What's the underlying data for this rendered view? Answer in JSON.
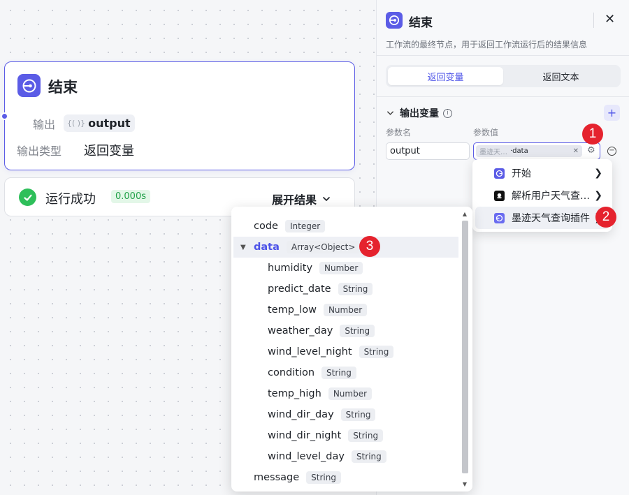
{
  "node": {
    "title": "结束",
    "output_label": "输出",
    "output_var": "output",
    "output_type_label": "输出类型",
    "output_type_value": "返回变量"
  },
  "run": {
    "status": "运行成功",
    "time": "0.000s",
    "expand_label": "展开结果"
  },
  "panel": {
    "title": "结束",
    "description": "工作流的最终节点，用于返回工作流运行后的结果信息",
    "tabs": [
      {
        "label": "返回变量",
        "active": true
      },
      {
        "label": "返回文本",
        "active": false
      }
    ],
    "section_title": "输出变量",
    "param_name_label": "参数名",
    "param_value_label": "参数值",
    "param_name": "output",
    "ref_source": "墨迹天…",
    "ref_field": "·data"
  },
  "source_menu": [
    {
      "label": "开始",
      "icon": "start-icon"
    },
    {
      "label": "解析用户天气查…",
      "icon": "parse-node-icon"
    },
    {
      "label": "墨迹天气查询插件",
      "icon": "moji-plugin-icon",
      "hovered": true
    }
  ],
  "callouts": [
    "1",
    "2",
    "3"
  ],
  "field_tree": [
    {
      "name": "code",
      "type": "Integer",
      "level": 0
    },
    {
      "name": "data",
      "type": "Array<Object>",
      "level": 0,
      "expanded": true,
      "selected": true
    },
    {
      "name": "humidity",
      "type": "Number",
      "level": 1
    },
    {
      "name": "predict_date",
      "type": "String",
      "level": 1
    },
    {
      "name": "temp_low",
      "type": "Number",
      "level": 1
    },
    {
      "name": "weather_day",
      "type": "String",
      "level": 1
    },
    {
      "name": "wind_level_night",
      "type": "String",
      "level": 1
    },
    {
      "name": "condition",
      "type": "String",
      "level": 1
    },
    {
      "name": "temp_high",
      "type": "Number",
      "level": 1
    },
    {
      "name": "wind_dir_day",
      "type": "String",
      "level": 1
    },
    {
      "name": "wind_dir_night",
      "type": "String",
      "level": 1
    },
    {
      "name": "wind_level_day",
      "type": "String",
      "level": 1
    },
    {
      "name": "message",
      "type": "String",
      "level": 0
    }
  ],
  "colors": {
    "accent": "#5b5ce6",
    "success": "#2ebf5a",
    "callout": "#e5232e"
  }
}
